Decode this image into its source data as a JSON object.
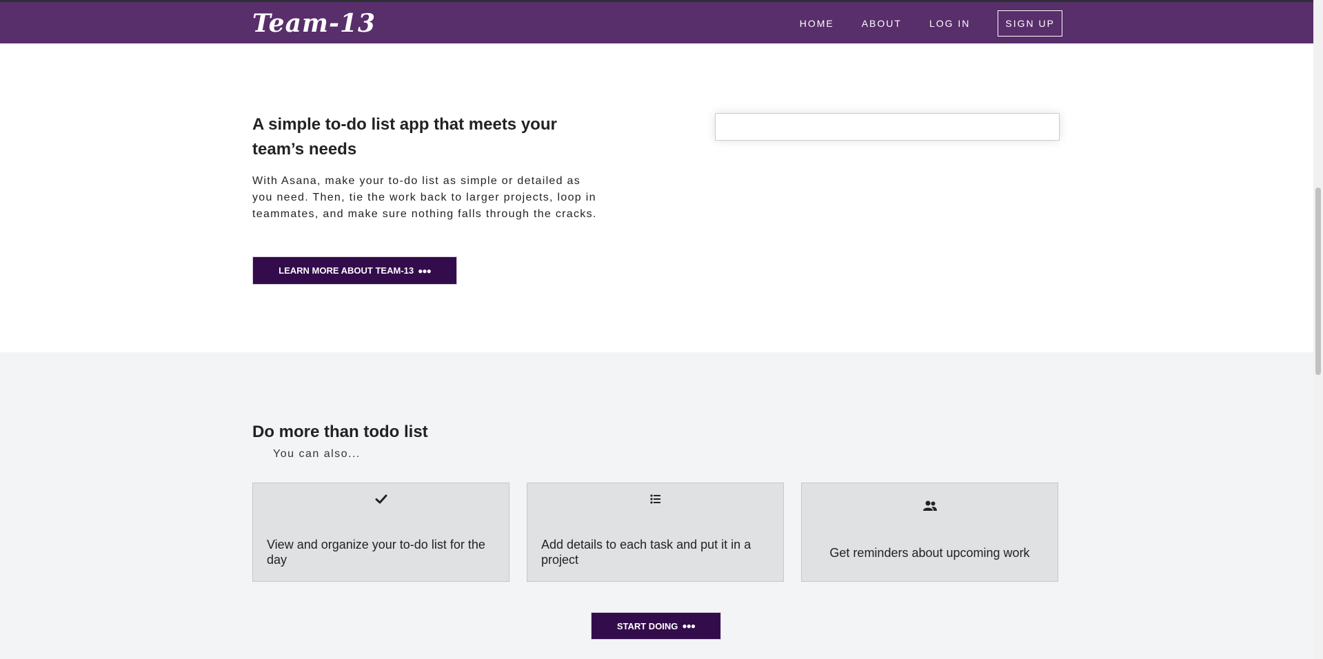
{
  "navbar": {
    "brand": "Team-13",
    "links": [
      {
        "label": "HOME"
      },
      {
        "label": "ABOUT"
      },
      {
        "label": "LOG IN"
      },
      {
        "label": "SIGN UP"
      }
    ],
    "background_color": "#582e6b"
  },
  "hero": {
    "title": "A simple to-do list app that meets your team’s needs",
    "text": "With Asana, make your to-do list as simple or detailed as you need. Then, tie the work back to larger projects, loop in teammates, and make sure nothing falls through the cracks.",
    "button_label": "LEARN MORE ABOUT TEAM-13",
    "input_value": "",
    "input_placeholder": ""
  },
  "features": {
    "title": "Do more than todo list",
    "subtitle": "You can also...",
    "cards": [
      {
        "icon": "check-icon",
        "text": "View and organize your to-do list for the day"
      },
      {
        "icon": "list-icon",
        "text": "Add details to each task and put it in a project"
      },
      {
        "icon": "users-icon",
        "text": "Get reminders about upcoming work"
      }
    ],
    "button_label": "START DOING"
  },
  "colors": {
    "accent_dark": "#330c4b",
    "section_bg": "#f3f4f6",
    "card_bg": "#e0e1e3"
  }
}
